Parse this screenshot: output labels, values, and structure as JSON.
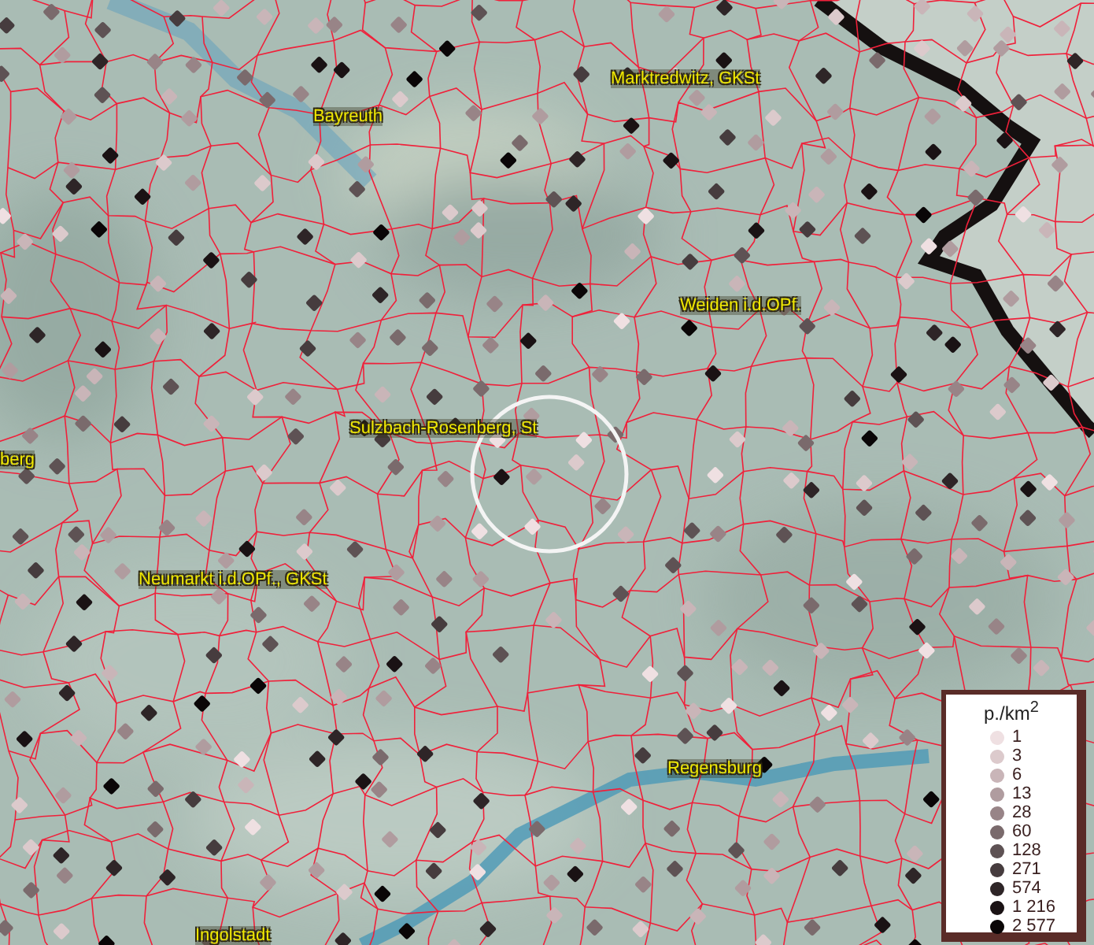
{
  "map": {
    "place_labels": [
      {
        "text": "Marktredwitz, GKSt"
      },
      {
        "text": "Bayreuth"
      },
      {
        "text": "Weiden i.d.OPf."
      },
      {
        "text": "Sulzbach-Rosenberg, St"
      },
      {
        "text": "berg"
      },
      {
        "text": "Neumarkt i.d.OPf., GKSt"
      },
      {
        "text": "Regensburg"
      },
      {
        "text": "Ingolstadt"
      }
    ]
  },
  "legend": {
    "title": "p./km$^{2}$",
    "items": [
      {
        "label": "1",
        "color": "#efe0e2"
      },
      {
        "label": "3",
        "color": "#dccacc"
      },
      {
        "label": "6",
        "color": "#c9b5b8"
      },
      {
        "label": "13",
        "color": "#b09c9f"
      },
      {
        "label": "28",
        "color": "#988487"
      },
      {
        "label": "60",
        "color": "#7a6a6c"
      },
      {
        "label": "128",
        "color": "#5e5254"
      },
      {
        "label": "271",
        "color": "#463c3e"
      },
      {
        "label": "574",
        "color": "#2e2527"
      },
      {
        "label": "1 216",
        "color": "#1a1214"
      },
      {
        "label": "2 577",
        "color": "#0a0607"
      }
    ]
  }
}
